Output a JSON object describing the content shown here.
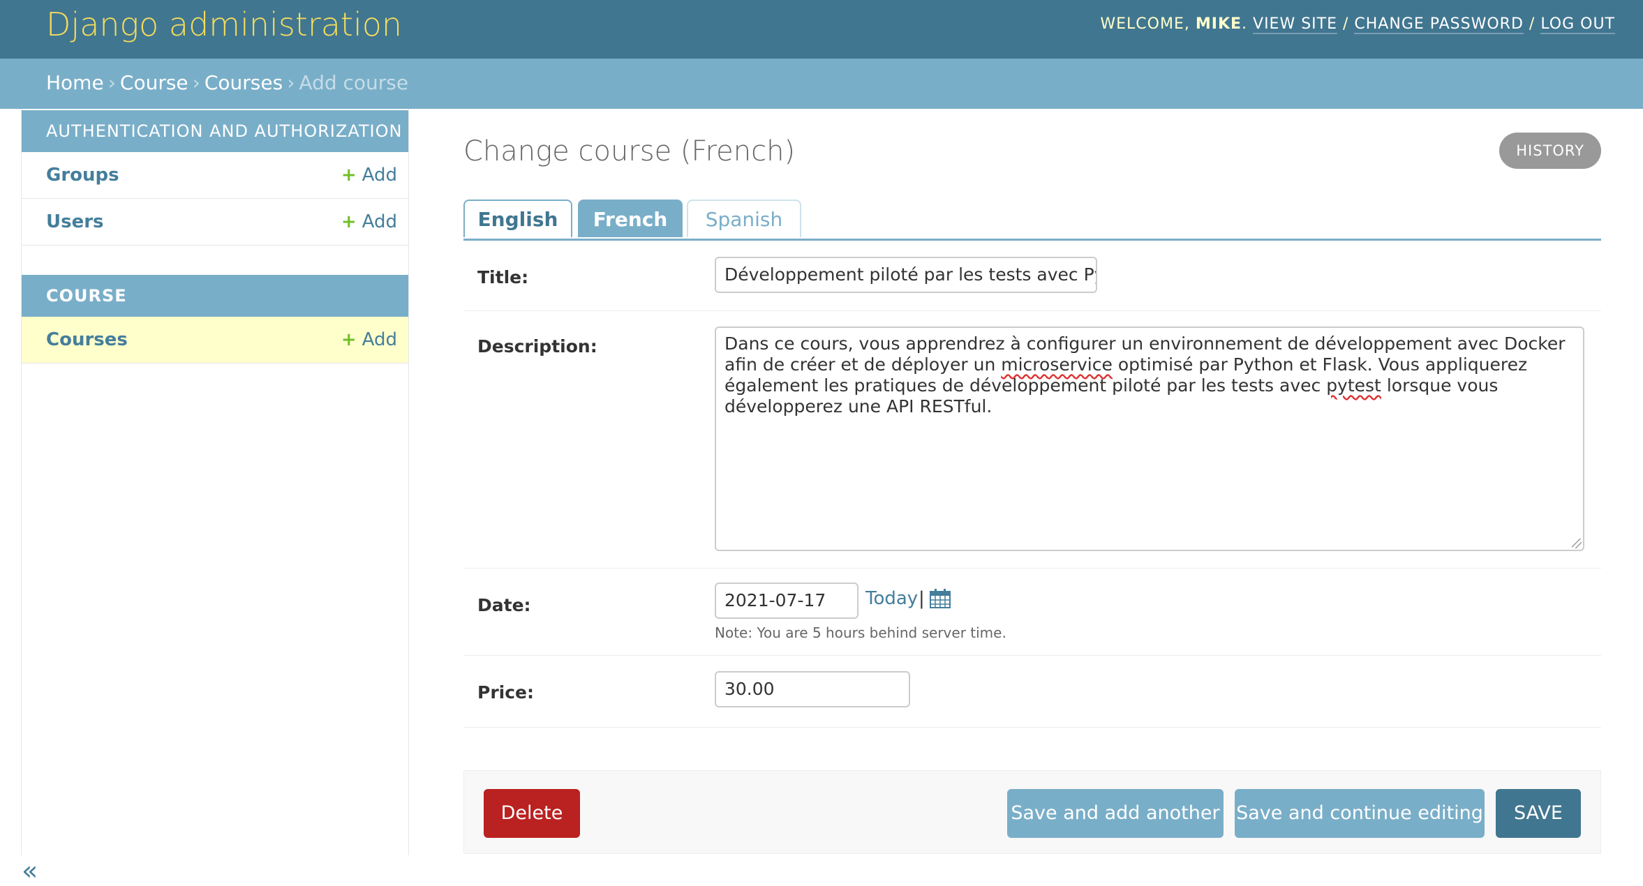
{
  "header": {
    "branding": "Django administration",
    "welcome": "Welcome,",
    "username": "Mike",
    "view_site": "View site",
    "change_password": "Change password",
    "log_out": "Log out"
  },
  "breadcrumbs": [
    "Home",
    "Course",
    "Courses",
    "Add course"
  ],
  "sidebar": {
    "modules": [
      {
        "caption": "Authentication and Authorization",
        "rows": [
          {
            "name": "Groups",
            "add": "Add"
          },
          {
            "name": "Users",
            "add": "Add"
          }
        ]
      },
      {
        "caption": "Course",
        "rows": [
          {
            "name": "Courses",
            "add": "Add"
          }
        ]
      }
    ],
    "collapse_glyph": "«"
  },
  "content": {
    "title": "Change course (French)",
    "history": "History",
    "tabs": [
      "English",
      "French",
      "Spanish"
    ],
    "active_tab": "French",
    "fields": {
      "title_label": "Title:",
      "title_value": "Développement piloté par les tests avec Python",
      "description_label": "Description:",
      "description_value_1": "Dans ce cours, vous apprendrez à configurer un environnement de développement avec Docker afin de créer et de déployer un ",
      "description_spell_1": "microservice",
      "description_value_2": " optimisé par Python et Flask. Vous appliquerez également les pratiques de développement piloté par les tests avec ",
      "description_spell_2": "pytest",
      "description_value_3": " lorsque vous développerez une API RESTful.",
      "date_label": "Date:",
      "date_value": "2021-07-17",
      "today": "Today",
      "pipe": "|",
      "date_note": "Note: You are 5 hours behind server time.",
      "price_label": "Price:",
      "price_value": "30.00"
    },
    "buttons": {
      "delete": "Delete",
      "save_add_another": "Save and add another",
      "save_continue": "Save and continue editing",
      "save": "SAVE"
    }
  },
  "colors": {
    "header_bg": "#417690",
    "branding": "#f5dd5d",
    "breadcrumb_bg": "#79aec8",
    "delete": "#ba2121",
    "add_plus": "#70bf2b",
    "current_row": "#ffffcc"
  },
  "icons": {
    "add": "plus-icon",
    "calendar": "calendar-icon",
    "collapse": "collapse-sidebar-icon"
  }
}
